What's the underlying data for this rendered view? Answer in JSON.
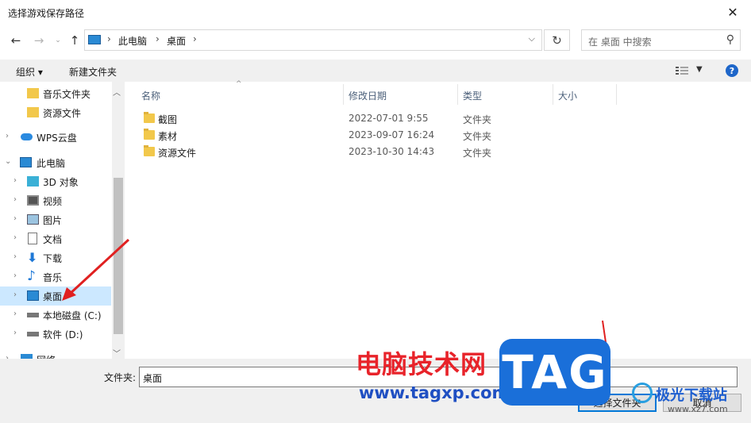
{
  "window": {
    "title": "选择游戏保存路径",
    "close_glyph": "✕"
  },
  "address": {
    "crumbs": [
      "此电脑",
      "桌面"
    ],
    "search_placeholder": "在 桌面 中搜索"
  },
  "toolbar": {
    "organize": "组织 ▾",
    "new_folder": "新建文件夹",
    "help": "?"
  },
  "nav": {
    "items": [
      {
        "label": "音乐文件夹",
        "icon": "folder-icon",
        "expandable": false
      },
      {
        "label": "资源文件",
        "icon": "folder-icon",
        "expandable": false
      },
      {
        "label": "WPS云盘",
        "icon": "cloud-icon",
        "expandable": true
      },
      {
        "label": "此电脑",
        "icon": "computer-icon",
        "expandable": true,
        "expanded": true
      },
      {
        "label": "3D 对象",
        "icon": "cube-icon",
        "expandable": true
      },
      {
        "label": "视频",
        "icon": "video-icon",
        "expandable": true
      },
      {
        "label": "图片",
        "icon": "picture-icon",
        "expandable": true
      },
      {
        "label": "文档",
        "icon": "document-icon",
        "expandable": true
      },
      {
        "label": "下载",
        "icon": "download-icon",
        "expandable": true
      },
      {
        "label": "音乐",
        "icon": "music-icon",
        "expandable": true
      },
      {
        "label": "桌面",
        "icon": "desktop-icon",
        "expandable": true,
        "selected": true
      },
      {
        "label": "本地磁盘 (C:)",
        "icon": "drive-icon",
        "expandable": true
      },
      {
        "label": "软件 (D:)",
        "icon": "drive-icon",
        "expandable": true
      },
      {
        "label": "网络",
        "icon": "network-icon",
        "expandable": true
      }
    ]
  },
  "columns": {
    "name": "名称",
    "date": "修改日期",
    "type": "类型",
    "size": "大小"
  },
  "files": [
    {
      "name": "截图",
      "date": "2022-07-01 9:55",
      "type": "文件夹"
    },
    {
      "name": "素材",
      "date": "2023-09-07 16:24",
      "type": "文件夹"
    },
    {
      "name": "资源文件",
      "date": "2023-10-30 14:43",
      "type": "文件夹"
    }
  ],
  "bottom": {
    "folder_label": "文件夹:",
    "folder_value": "桌面",
    "ok": "选择文件夹",
    "cancel": "取消"
  },
  "watermark": {
    "site_cn": "电脑技术网",
    "site_url": "www.tagxp.com",
    "tag": "TAG",
    "logo": "极光下载站",
    "logo_url": "www.xz7.com"
  },
  "colors": {
    "accent": "#0078d7",
    "selection": "#cce8ff",
    "folder": "#f2c84b",
    "annotation_arrow": "#e02020"
  }
}
